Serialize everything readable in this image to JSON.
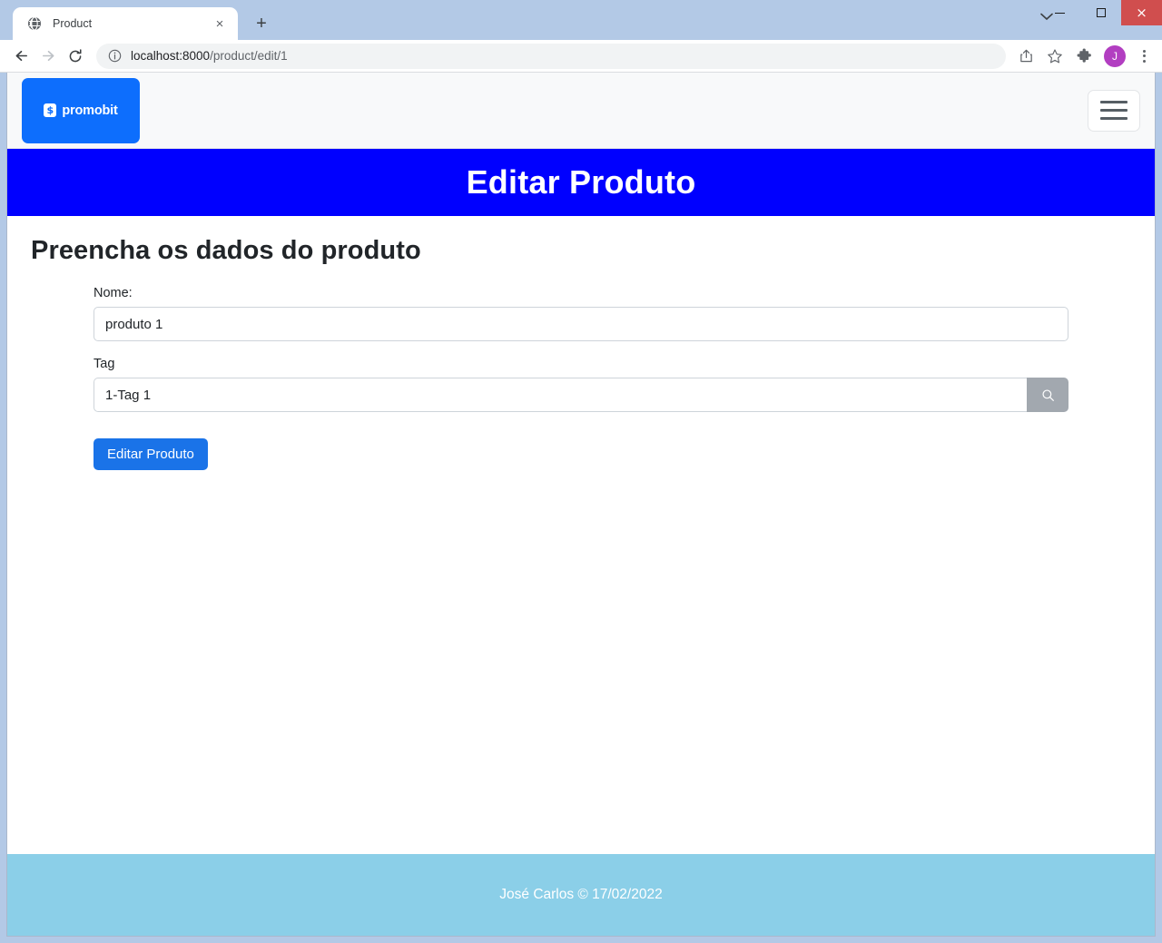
{
  "browser": {
    "tab": {
      "title": "Product",
      "favicon_icon": "globe-icon",
      "close_icon": "×"
    },
    "new_tab_icon": "+",
    "tab_list_chevron_icon": "⌄",
    "window_controls": {
      "minimize_label": "minimize-icon",
      "maximize_label": "maximize-icon",
      "close_label": "×"
    },
    "toolbar": {
      "back_icon": "back-arrow-icon",
      "forward_icon": "forward-arrow-icon",
      "reload_icon": "reload-icon",
      "site_info_icon": "info-circle-icon",
      "url_host": "localhost:8000",
      "url_path": "/product/edit/1",
      "share_icon": "share-icon",
      "bookmark_icon": "star-icon",
      "extensions_icon": "puzzle-icon",
      "profile_initial": "J",
      "menu_icon": "kebab-menu-icon"
    }
  },
  "site": {
    "brand": {
      "mark": "$",
      "name": "promobit"
    },
    "navbar_toggler_label": "menu-toggle"
  },
  "page": {
    "banner_title": "Editar Produto",
    "section_title": "Preencha os dados do produto",
    "form": {
      "name_field": {
        "label": "Nome:",
        "value": "produto 1",
        "placeholder": "Nome"
      },
      "tag_field": {
        "label": "Tag",
        "value": "1-Tag 1",
        "placeholder": "Tag",
        "search_button_icon": "search-icon"
      },
      "submit_label": "Editar Produto"
    }
  },
  "footer": {
    "text": "José Carlos © 17/02/2022"
  },
  "colors": {
    "banner_blue": "#0000ff",
    "brand_blue": "#0d6efd",
    "button_blue": "#1a73e8",
    "footer_blue": "#8bcfe8",
    "addon_gray": "#a2a8af"
  }
}
